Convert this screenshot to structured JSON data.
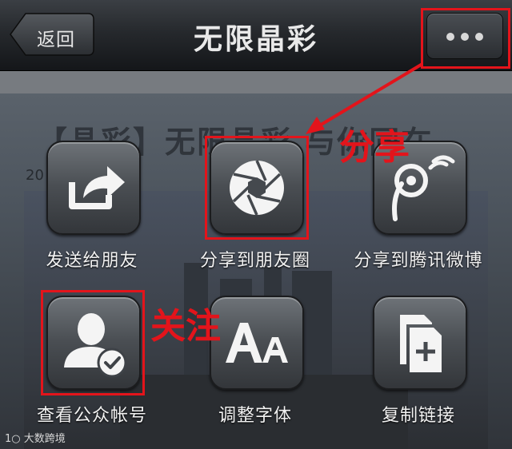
{
  "nav": {
    "back_label": "返回",
    "title": "无限晶彩"
  },
  "article": {
    "title": "【晶彩】无限晶彩 与你同在",
    "date": "20"
  },
  "share_items": [
    {
      "label": "发送给朋友",
      "icon": "share-arrow-icon"
    },
    {
      "label": "分享到朋友圈",
      "icon": "aperture-icon"
    },
    {
      "label": "分享到腾讯微博",
      "icon": "tencent-weibo-icon"
    },
    {
      "label": "查看公众帐号",
      "icon": "user-check-icon"
    },
    {
      "label": "调整字体",
      "icon": "font-size-icon"
    },
    {
      "label": "复制链接",
      "icon": "copy-link-icon"
    }
  ],
  "annotations": {
    "share": "分享",
    "follow": "关注"
  },
  "watermark": "大数跨境",
  "colors": {
    "annotation_red": "#e3141b"
  }
}
